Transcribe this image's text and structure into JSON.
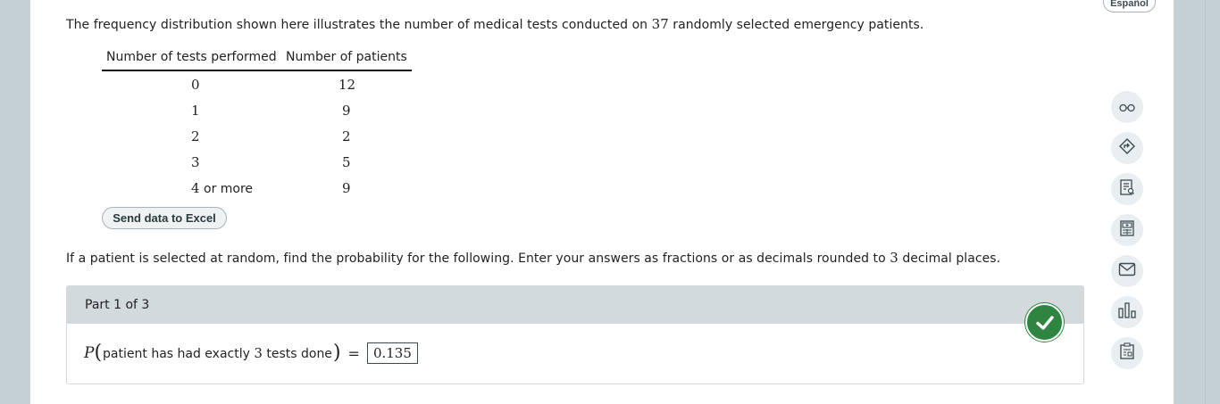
{
  "header": {
    "espanol_label": "Español"
  },
  "intro": {
    "before": "The frequency distribution shown here illustrates the number of medical tests conducted on ",
    "count": "37",
    "after": " randomly selected emergency patients."
  },
  "table": {
    "columns": [
      "Number of tests performed",
      "Number of patients"
    ],
    "rows": [
      {
        "tests": "0",
        "patients": "12"
      },
      {
        "tests": "1",
        "patients": "9"
      },
      {
        "tests": "2",
        "patients": "2"
      },
      {
        "tests": "3",
        "patients": "5"
      },
      {
        "tests_num": "4",
        "tests_suffix": " or more",
        "patients": "9"
      }
    ]
  },
  "excel_button_label": "Send data to Excel",
  "instructions": {
    "before": "If a patient is selected at random, find the probability for the following. Enter your answers as fractions or as decimals rounded to ",
    "places": "3",
    "after": " decimal places."
  },
  "part": {
    "label": "Part 1 of 3",
    "status": "correct"
  },
  "equation": {
    "p": "P",
    "open": "(",
    "text_before": "patient has had exactly ",
    "count": "3",
    "text_after": " tests done",
    "close": ")",
    "equals": "=",
    "answer": "0.135"
  },
  "sidebar_tools": [
    "glasses-icon",
    "compass-icon",
    "notes-icon",
    "calculator-icon",
    "mail-icon",
    "chart-icon",
    "clipboard-icon"
  ],
  "colors": {
    "check_green": "#2e8540",
    "background": "#c5d0d4",
    "part_header": "#d3dadd"
  }
}
